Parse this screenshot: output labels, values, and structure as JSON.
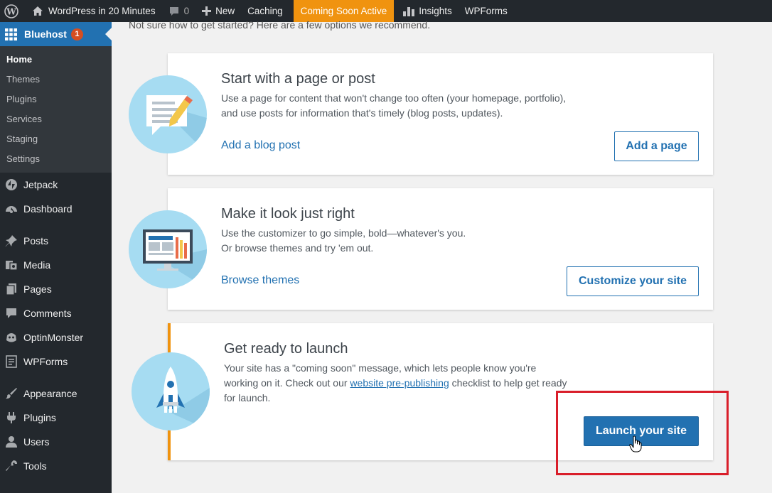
{
  "admin_bar": {
    "site_name": "WordPress in 20 Minutes",
    "comments_count": "0",
    "new_label": "New",
    "caching_label": "Caching",
    "coming_soon_label": "Coming Soon Active",
    "insights_label": "Insights",
    "wpforms_label": "WPForms"
  },
  "sidebar": {
    "bluehost_label": "Bluehost",
    "bluehost_badge": "1",
    "submenu": [
      "Home",
      "Themes",
      "Plugins",
      "Services",
      "Staging",
      "Settings"
    ],
    "menu": [
      {
        "label": "Jetpack",
        "icon": "jetpack-icon"
      },
      {
        "label": "Dashboard",
        "icon": "dashboard-icon"
      },
      {
        "label": "Posts",
        "icon": "posts-pin-icon"
      },
      {
        "label": "Media",
        "icon": "media-icon"
      },
      {
        "label": "Pages",
        "icon": "pages-icon"
      },
      {
        "label": "Comments",
        "icon": "comments-icon"
      },
      {
        "label": "OptinMonster",
        "icon": "optinmonster-icon"
      },
      {
        "label": "WPForms",
        "icon": "wpforms-icon"
      },
      {
        "label": "Appearance",
        "icon": "appearance-brush-icon"
      },
      {
        "label": "Plugins",
        "icon": "plugins-icon"
      },
      {
        "label": "Users",
        "icon": "users-icon"
      },
      {
        "label": "Tools",
        "icon": "tools-wrench-icon"
      }
    ]
  },
  "main": {
    "intro": "Not sure how to get started? Here are a few options we recommend.",
    "cards": [
      {
        "title": "Start with a page or post",
        "description": "Use a page for content that won't change too often (your homepage, portfolio), and use posts for information that's timely (blog posts, updates).",
        "link": "Add a blog post",
        "button": "Add a page"
      },
      {
        "title": "Make it look just right",
        "description_line1": "Use the customizer to go simple, bold—whatever's you.",
        "description_line2": "Or browse themes and try 'em out.",
        "link": "Browse themes",
        "button": "Customize your site"
      },
      {
        "title": "Get ready to launch",
        "description_before": "Your site has a \"coming soon\" message, which lets people know you're working on it. Check out our ",
        "description_link": "website pre-publishing",
        "description_after": " checklist to help get ready for launch.",
        "button": "Launch your site"
      }
    ]
  },
  "colors": {
    "accent": "#2271b1",
    "coming_soon": "#f0930f",
    "highlight": "#d91e2a",
    "admin_dark": "#23282d"
  }
}
